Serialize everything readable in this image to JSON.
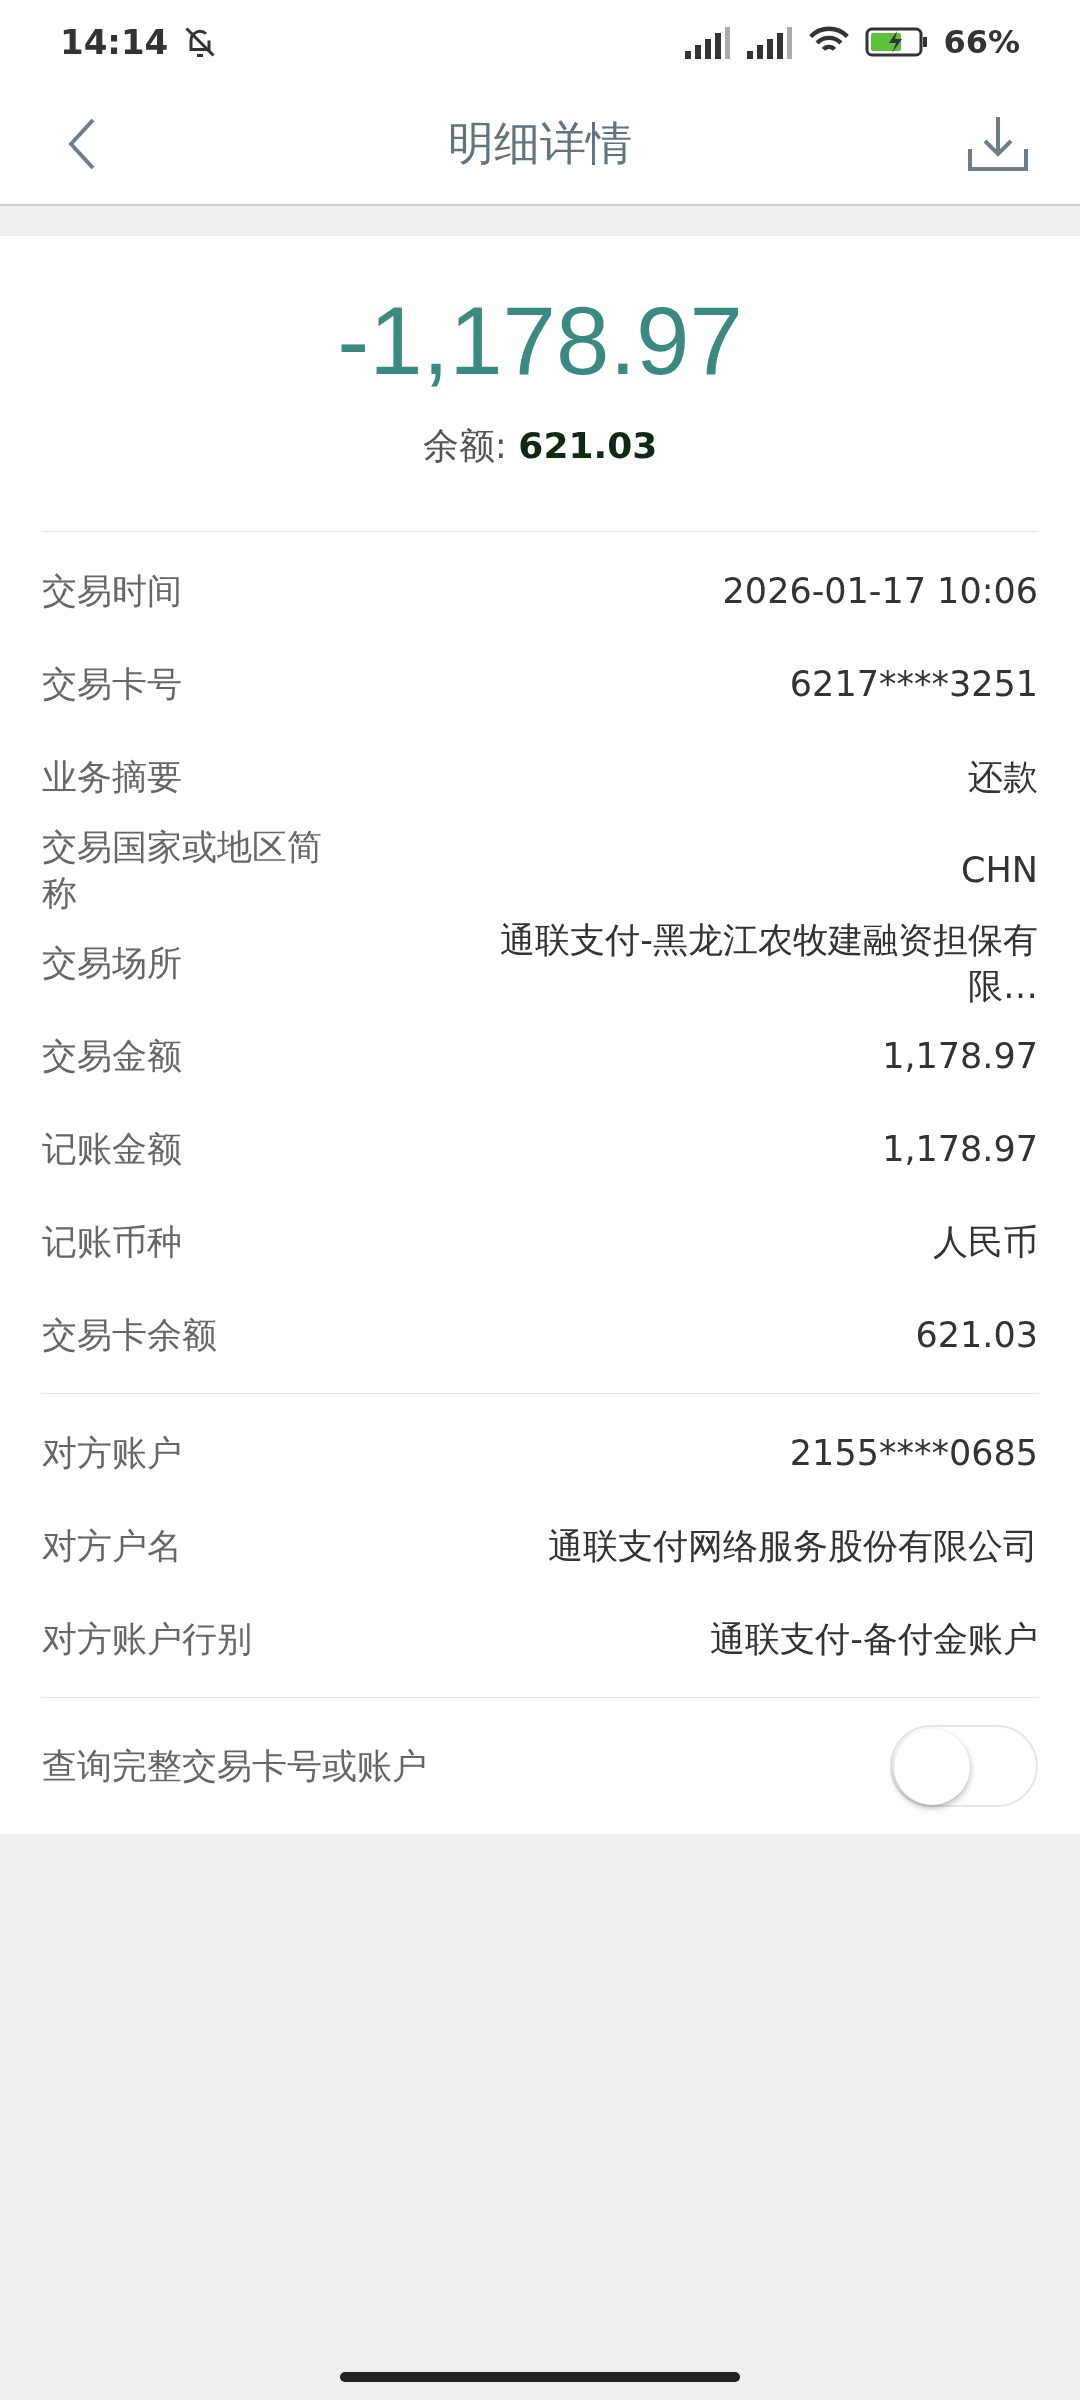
{
  "status_bar": {
    "time": "14:14",
    "battery": "66%"
  },
  "header": {
    "title": "明细详情"
  },
  "summary": {
    "amount": "-1,178.97",
    "balance_label": "余额:",
    "balance": "621.03"
  },
  "sections": [
    {
      "rows": [
        {
          "label": "交易时间",
          "value": "2026-01-17 10:06"
        },
        {
          "label": "交易卡号",
          "value": "6217****3251"
        },
        {
          "label": "业务摘要",
          "value": "还款"
        },
        {
          "label": "交易国家或地区简称",
          "value": "CHN"
        },
        {
          "label": "交易场所",
          "value": "通联支付-黑龙江农牧建融资担保有限…"
        },
        {
          "label": "交易金额",
          "value": "1,178.97"
        },
        {
          "label": "记账金额",
          "value": "1,178.97"
        },
        {
          "label": "记账币种",
          "value": "人民币"
        },
        {
          "label": "交易卡余额",
          "value": "621.03"
        }
      ]
    },
    {
      "rows": [
        {
          "label": "对方账户",
          "value": "2155****0685"
        },
        {
          "label": "对方户名",
          "value": "通联支付网络服务股份有限公司"
        },
        {
          "label": "对方账户行别",
          "value": "通联支付-备付金账户"
        }
      ]
    }
  ],
  "toggle": {
    "label": "查询完整交易卡号或账户",
    "on": false
  }
}
